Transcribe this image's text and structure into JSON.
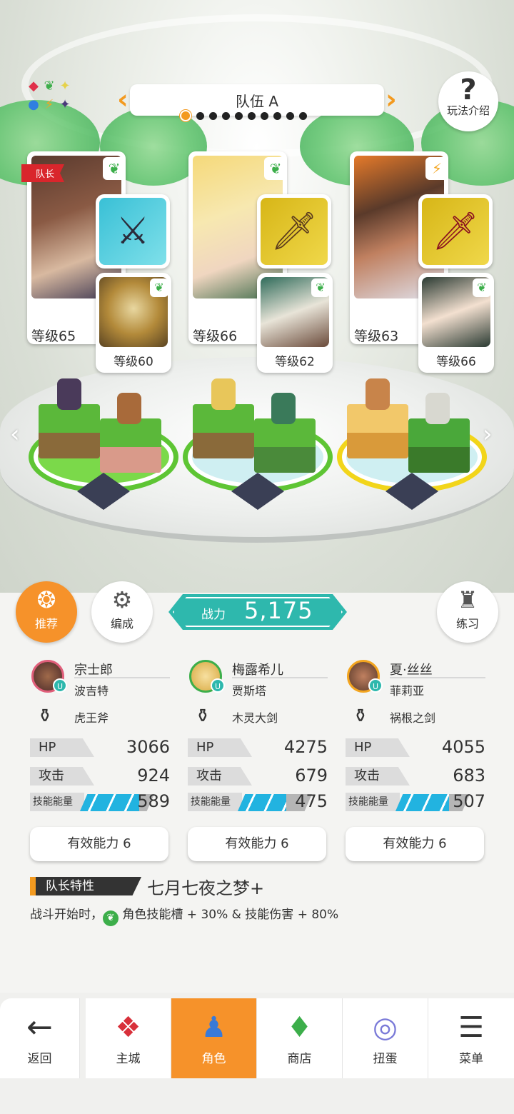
{
  "team": {
    "name": "队伍 A",
    "page_count": 10,
    "active_page": 1
  },
  "help": {
    "label": "玩法介绍"
  },
  "attributes": {
    "icons": [
      "red-diamond",
      "leaf",
      "star",
      "blue-circle",
      "lightning",
      "dark-star"
    ]
  },
  "members": [
    {
      "captain_label": "队长",
      "element": "wood",
      "level": "等级65",
      "support_level": "等级60",
      "name": "宗士郎",
      "support_name": "波吉特",
      "weapon_name": "虎王斧",
      "hp_label": "HP",
      "hp": "3066",
      "atk_label": "攻击",
      "atk": "924",
      "skill_label": "技能能量",
      "skill": "589",
      "skill_fill_percent": 80,
      "effective_label": "有效能力 6"
    },
    {
      "element": "wood",
      "level": "等级66",
      "support_level": "等级62",
      "name": "梅露希儿",
      "support_name": "贾斯塔",
      "weapon_name": "木灵大剑",
      "hp_label": "HP",
      "hp": "4275",
      "atk_label": "攻击",
      "atk": "679",
      "skill_label": "技能能量",
      "skill": "475",
      "skill_fill_percent": 65,
      "effective_label": "有效能力 6"
    },
    {
      "element": "lightning",
      "level": "等级63",
      "support_level": "等级66",
      "name": "夏·丝丝",
      "support_name": "菲莉亚",
      "weapon_name": "祸根之剑",
      "hp_label": "HP",
      "hp": "4055",
      "atk_label": "攻击",
      "atk": "683",
      "skill_label": "技能能量",
      "skill": "507",
      "skill_fill_percent": 72,
      "effective_label": "有效能力 6"
    }
  ],
  "actions": {
    "recommend": "推荐",
    "formation": "编成",
    "practice": "练习"
  },
  "power": {
    "label": "战力",
    "value": "5,175"
  },
  "leader": {
    "tag": "队长特性",
    "trait": "七月七夜之梦+",
    "desc_prefix": "战斗开始时，",
    "desc_suffix": "角色技能槽 + 30% & 技能伤害 + 80%"
  },
  "nav": {
    "back": "返回",
    "home": "主城",
    "characters": "角色",
    "shop": "商店",
    "gacha": "扭蛋",
    "menu": "菜单"
  },
  "colors": {
    "accent": "#f6922a",
    "teal": "#2eb8ad",
    "wood": "#3cae4a",
    "lightning": "#f3a51f"
  }
}
